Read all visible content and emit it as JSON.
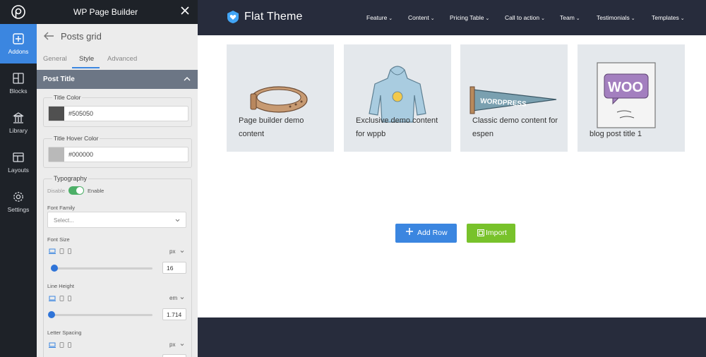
{
  "builder": {
    "title": "WP Page Builder",
    "rail": [
      {
        "label": "Addons",
        "icon": "plus-square-icon",
        "active": true
      },
      {
        "label": "Blocks",
        "icon": "blocks-icon",
        "active": false
      },
      {
        "label": "Library",
        "icon": "library-icon",
        "active": false
      },
      {
        "label": "Layouts",
        "icon": "layouts-icon",
        "active": false
      },
      {
        "label": "Settings",
        "icon": "gear-icon",
        "active": false
      }
    ],
    "panel_title": "Posts grid",
    "tabs": [
      "General",
      "Style",
      "Advanced"
    ],
    "active_tab": "Style",
    "section": "Post Title",
    "title_color": {
      "label": "Title Color",
      "value": "#505050"
    },
    "title_hover_color": {
      "label": "Title Hover Color",
      "value": "#000000"
    },
    "typography": {
      "label": "Typography",
      "toggle_off": "Disable",
      "toggle_on": "Enable",
      "enabled": true,
      "font_family_label": "Font Family",
      "font_family_placeholder": "Select...",
      "font_size_label": "Font Size",
      "font_size_unit": "px",
      "font_size_value": "16",
      "line_height_label": "Line Height",
      "line_height_unit": "em",
      "line_height_value": "1.714",
      "letter_spacing_label": "Letter Spacing",
      "letter_spacing_unit": "px"
    }
  },
  "site": {
    "brand": "Flat Theme",
    "nav": [
      "Feature",
      "Content",
      "Pricing Table",
      "Call to action",
      "Team",
      "Testimonials",
      "Templates"
    ],
    "posts": [
      {
        "title": "Page builder demo content",
        "image": "belt"
      },
      {
        "title": "Exclusive demo content for wppb",
        "image": "hoodie"
      },
      {
        "title": "Classic demo content for espen",
        "image": "wordpress-pennant"
      },
      {
        "title": "blog post title 1",
        "image": "woo-poster"
      }
    ],
    "add_row_label": "Add Row",
    "import_label": "Import"
  },
  "colors": {
    "accent": "#3b86e0",
    "dark": "#1e2228",
    "nav_bg": "#272c3c",
    "import_green": "#78c22b",
    "toggle_green": "#4caf67",
    "title_swatch": "#505050",
    "hover_swatch": "#b9b9b9"
  }
}
